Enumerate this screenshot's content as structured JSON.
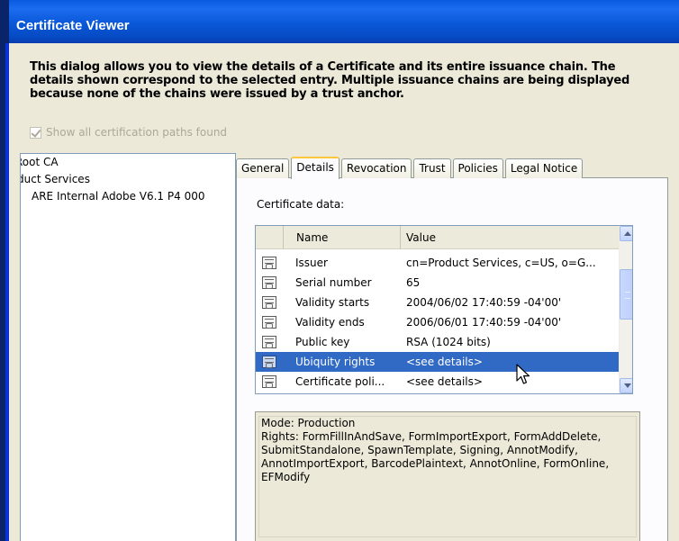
{
  "window": {
    "title": "Certificate Viewer"
  },
  "intro": {
    "line1": "This dialog allows you to view the details of a Certificate and its entire issuance chain. The",
    "line2": "details shown correspond to the selected entry. Multiple issuance chains are being displayed",
    "line3": "because none of the chains were issued by a trust anchor."
  },
  "show_all_paths": {
    "label": "Show all certification paths found",
    "checked": true,
    "enabled": false
  },
  "chain": [
    {
      "label": "Root CA"
    },
    {
      "label": "duct Services"
    },
    {
      "label": "ARE Internal Adobe V6.1 P4 000"
    }
  ],
  "tabs": [
    {
      "label": "General",
      "active": false
    },
    {
      "label": "Details",
      "active": true
    },
    {
      "label": "Revocation",
      "active": false
    },
    {
      "label": "Trust",
      "active": false
    },
    {
      "label": "Policies",
      "active": false
    },
    {
      "label": "Legal Notice",
      "active": false
    }
  ],
  "details": {
    "section_label": "Certificate data:",
    "columns": {
      "name": "Name",
      "value": "Value"
    },
    "rows": [
      {
        "name": "Issuer",
        "value": "cn=Product Services, c=US, o=G...",
        "selected": false
      },
      {
        "name": "Serial number",
        "value": "65",
        "selected": false
      },
      {
        "name": "Validity starts",
        "value": "2004/06/02 17:40:59 -04'00'",
        "selected": false
      },
      {
        "name": "Validity ends",
        "value": "2006/06/01 17:40:59 -04'00'",
        "selected": false
      },
      {
        "name": "Public key",
        "value": "RSA (1024 bits)",
        "selected": false
      },
      {
        "name": "Ubiquity rights",
        "value": "<see details>",
        "selected": true
      },
      {
        "name": "Certificate poli...",
        "value": "<see details>",
        "selected": false
      }
    ],
    "detail_text": {
      "line1": "Mode:  Production",
      "line2": "Rights: FormFillInAndSave, FormImportExport, FormAddDelete,",
      "line3": "SubmitStandalone, SpawnTemplate, Signing, AnnotModify,",
      "line4": "AnnotImportExport, BarcodePlaintext, AnnotOnline, FormOnline,",
      "line5": "EFModify"
    }
  },
  "colors": {
    "titlebar": "#0a58d8",
    "selection": "#316ac5",
    "dialog_bg": "#ece9d8"
  }
}
